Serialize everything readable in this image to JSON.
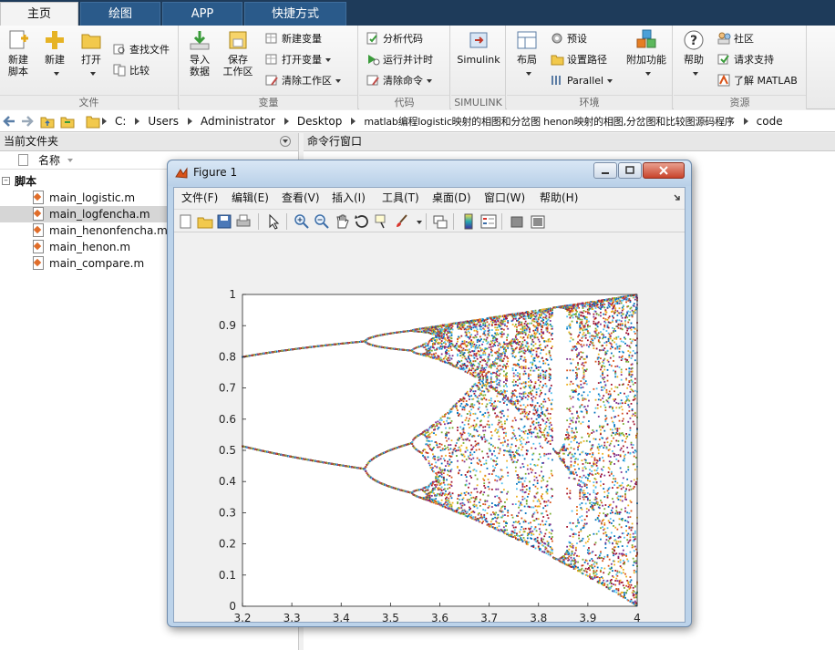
{
  "tabs": [
    {
      "label": "主页",
      "active": true
    },
    {
      "label": "绘图",
      "active": false
    },
    {
      "label": "APP",
      "active": false
    },
    {
      "label": "快捷方式",
      "active": false
    }
  ],
  "ribbon": {
    "file": {
      "label": "文件",
      "new_script": "新建\n脚本",
      "new": "新建",
      "open": "打开",
      "find_files": "查找文件",
      "compare": "比较"
    },
    "variable": {
      "label": "变量",
      "import": "导入\n数据",
      "save": "保存\n工作区",
      "new_variable": "新建变量",
      "open_variable": "打开变量",
      "clear_workspace": "清除工作区"
    },
    "code": {
      "label": "代码",
      "analyze": "分析代码",
      "run_time": "运行并计时",
      "clear_commands": "清除命令"
    },
    "simulink": {
      "label": "SIMULINK",
      "button": "Simulink"
    },
    "environment": {
      "label": "环境",
      "layout": "布局",
      "preferences": "预设",
      "set_path": "设置路径",
      "parallel": "Parallel",
      "addons": "附加功能"
    },
    "resources": {
      "label": "资源",
      "help": "帮助",
      "community": "社区",
      "request_support": "请求支持",
      "learn_matlab": "了解 MATLAB"
    }
  },
  "address": {
    "crumbs": [
      "C:",
      "Users",
      "Administrator",
      "Desktop",
      "matlab编程logistic映射的相图和分岔图 henon映射的相图,分岔图和比较图源码程序",
      "code"
    ]
  },
  "current_folder": {
    "title": "当前文件夹",
    "column": "名称",
    "group": "脚本",
    "files": [
      {
        "name": "main_logistic.m",
        "selected": false
      },
      {
        "name": "main_logfencha.m",
        "selected": true
      },
      {
        "name": "main_henonfencha.m",
        "selected": false
      },
      {
        "name": "main_henon.m",
        "selected": false
      },
      {
        "name": "main_compare.m",
        "selected": false
      }
    ]
  },
  "command_window": {
    "title": "命令行窗口"
  },
  "figure": {
    "title": "Figure 1",
    "menus": [
      "文件(F)",
      "编辑(E)",
      "查看(V)",
      "插入(I)",
      "工具(T)",
      "桌面(D)",
      "窗口(W)",
      "帮助(H)"
    ]
  },
  "chart_data": {
    "type": "scatter",
    "title": "",
    "xlabel": "",
    "ylabel": "",
    "xlim": [
      3.2,
      4
    ],
    "ylim": [
      0,
      1
    ],
    "xticks": [
      3.2,
      3.3,
      3.4,
      3.5,
      3.6,
      3.7,
      3.8,
      3.9,
      4
    ],
    "yticks": [
      0,
      0.1,
      0.2,
      0.3,
      0.4,
      0.5,
      0.6,
      0.7,
      0.8,
      0.9,
      1
    ],
    "xtick_labels": [
      "3.2",
      "3.3",
      "3.4",
      "3.5",
      "3.6",
      "3.7",
      "3.8",
      "3.9",
      "4"
    ],
    "ytick_labels": [
      "0",
      "0.1",
      "0.2",
      "0.3",
      "0.4",
      "0.5",
      "0.6",
      "0.7",
      "0.8",
      "0.9",
      "1"
    ],
    "r_step": 0.002,
    "iterations_shown": 30,
    "grid": false,
    "colors": [
      "#0072BD",
      "#D95319",
      "#EDB120",
      "#7E2F8E",
      "#77AC30",
      "#4DBEEE",
      "#A2142F"
    ]
  }
}
